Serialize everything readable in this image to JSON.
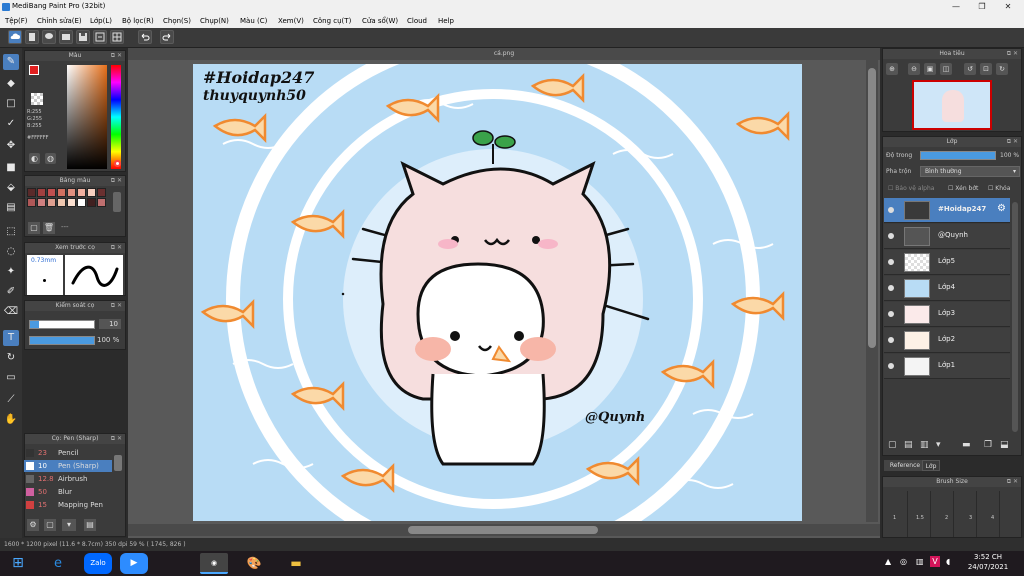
{
  "window": {
    "title": "MediBang Paint Pro (32bit)",
    "minimize": "—",
    "maximize": "❐",
    "close": "✕"
  },
  "menu": [
    "Tệp(F)",
    "Chỉnh sửa(E)",
    "Lớp(L)",
    "Bộ lọc(R)",
    "Chọn(S)",
    "Chụp(N)",
    "Màu (C)",
    "Xem(V)",
    "Công cụ(T)",
    "Cửa sổ(W)",
    "Cloud",
    "Help"
  ],
  "document": {
    "tab_title": "cá.png"
  },
  "color_panel": {
    "title": "Màu",
    "r": "R:255",
    "g": "G:255",
    "b": "B:255",
    "hex": "#FFFFFF",
    "foreground": "#e02020",
    "background": "#ffffff"
  },
  "palette_panel": {
    "title": "Bảng màu",
    "more": "---",
    "swatches": [
      "#5a2a2a",
      "#a04040",
      "#c05050",
      "#d07060",
      "#e09080",
      "#f0b0a0",
      "#f8d0c0",
      "#6a3030",
      "#b05858",
      "#d08080",
      "#e0a090",
      "#f0c8b0",
      "#fbe0d0",
      "#ffffff",
      "#402020",
      "#c07070"
    ]
  },
  "preview_panel": {
    "title": "Xem trước cọ",
    "size": "0.73mm"
  },
  "control_panel": {
    "title": "Kiểm soát cọ",
    "size_value": "10",
    "opacity_value": "100 %"
  },
  "brush_panel": {
    "title": "Cọ: Pen (Sharp)",
    "brushes": [
      {
        "size": "23",
        "name": "Pencil",
        "color": "#333333"
      },
      {
        "size": "10",
        "name": "Pen (Sharp)",
        "color": "#ffffff",
        "selected": true
      },
      {
        "size": "12.8",
        "name": "Airbrush",
        "color": "#666666"
      },
      {
        "size": "50",
        "name": "Blur",
        "color": "#d060a0"
      },
      {
        "size": "15",
        "name": "Mapping Pen",
        "color": "#d04040"
      }
    ]
  },
  "navigator": {
    "title": "Hoa tiêu"
  },
  "layers_panel": {
    "title": "Lớp",
    "opacity_label": "Độ trong",
    "opacity_value": "100 %",
    "blend_label": "Pha trộn",
    "blend_value": "Bình thường",
    "protect_alpha": "Bảo vệ alpha",
    "clipping": "Xén bớt",
    "lock": "Khóa",
    "layers": [
      {
        "name": "#Hoidap247",
        "selected": true
      },
      {
        "name": "@Quynh"
      },
      {
        "name": "Lớp5"
      },
      {
        "name": "Lớp4"
      },
      {
        "name": "Lớp3"
      },
      {
        "name": "Lớp2"
      },
      {
        "name": "Lớp1"
      }
    ]
  },
  "ref_tabs": {
    "reference": "Reference",
    "layer": "Lớp"
  },
  "brush_size_panel": {
    "title": "Brush Size",
    "sizes": [
      "1",
      "1.5",
      "2",
      "3",
      "4"
    ]
  },
  "status": {
    "text": "1600 * 1200 pixel  (11.6 * 8.7cm)  350 dpi  59 %  ( 1745, 826 )"
  },
  "artwork": {
    "watermark1": "#Hoidap247",
    "watermark2": "thuyquynh50",
    "signature": "@Quynh"
  },
  "taskbar": {
    "time": "3:52 CH",
    "date": "24/07/2021",
    "zalo": "Zalo",
    "lang": "V"
  },
  "colors": {
    "accent": "#4a7fbf",
    "sky": "#b8dcf5"
  }
}
